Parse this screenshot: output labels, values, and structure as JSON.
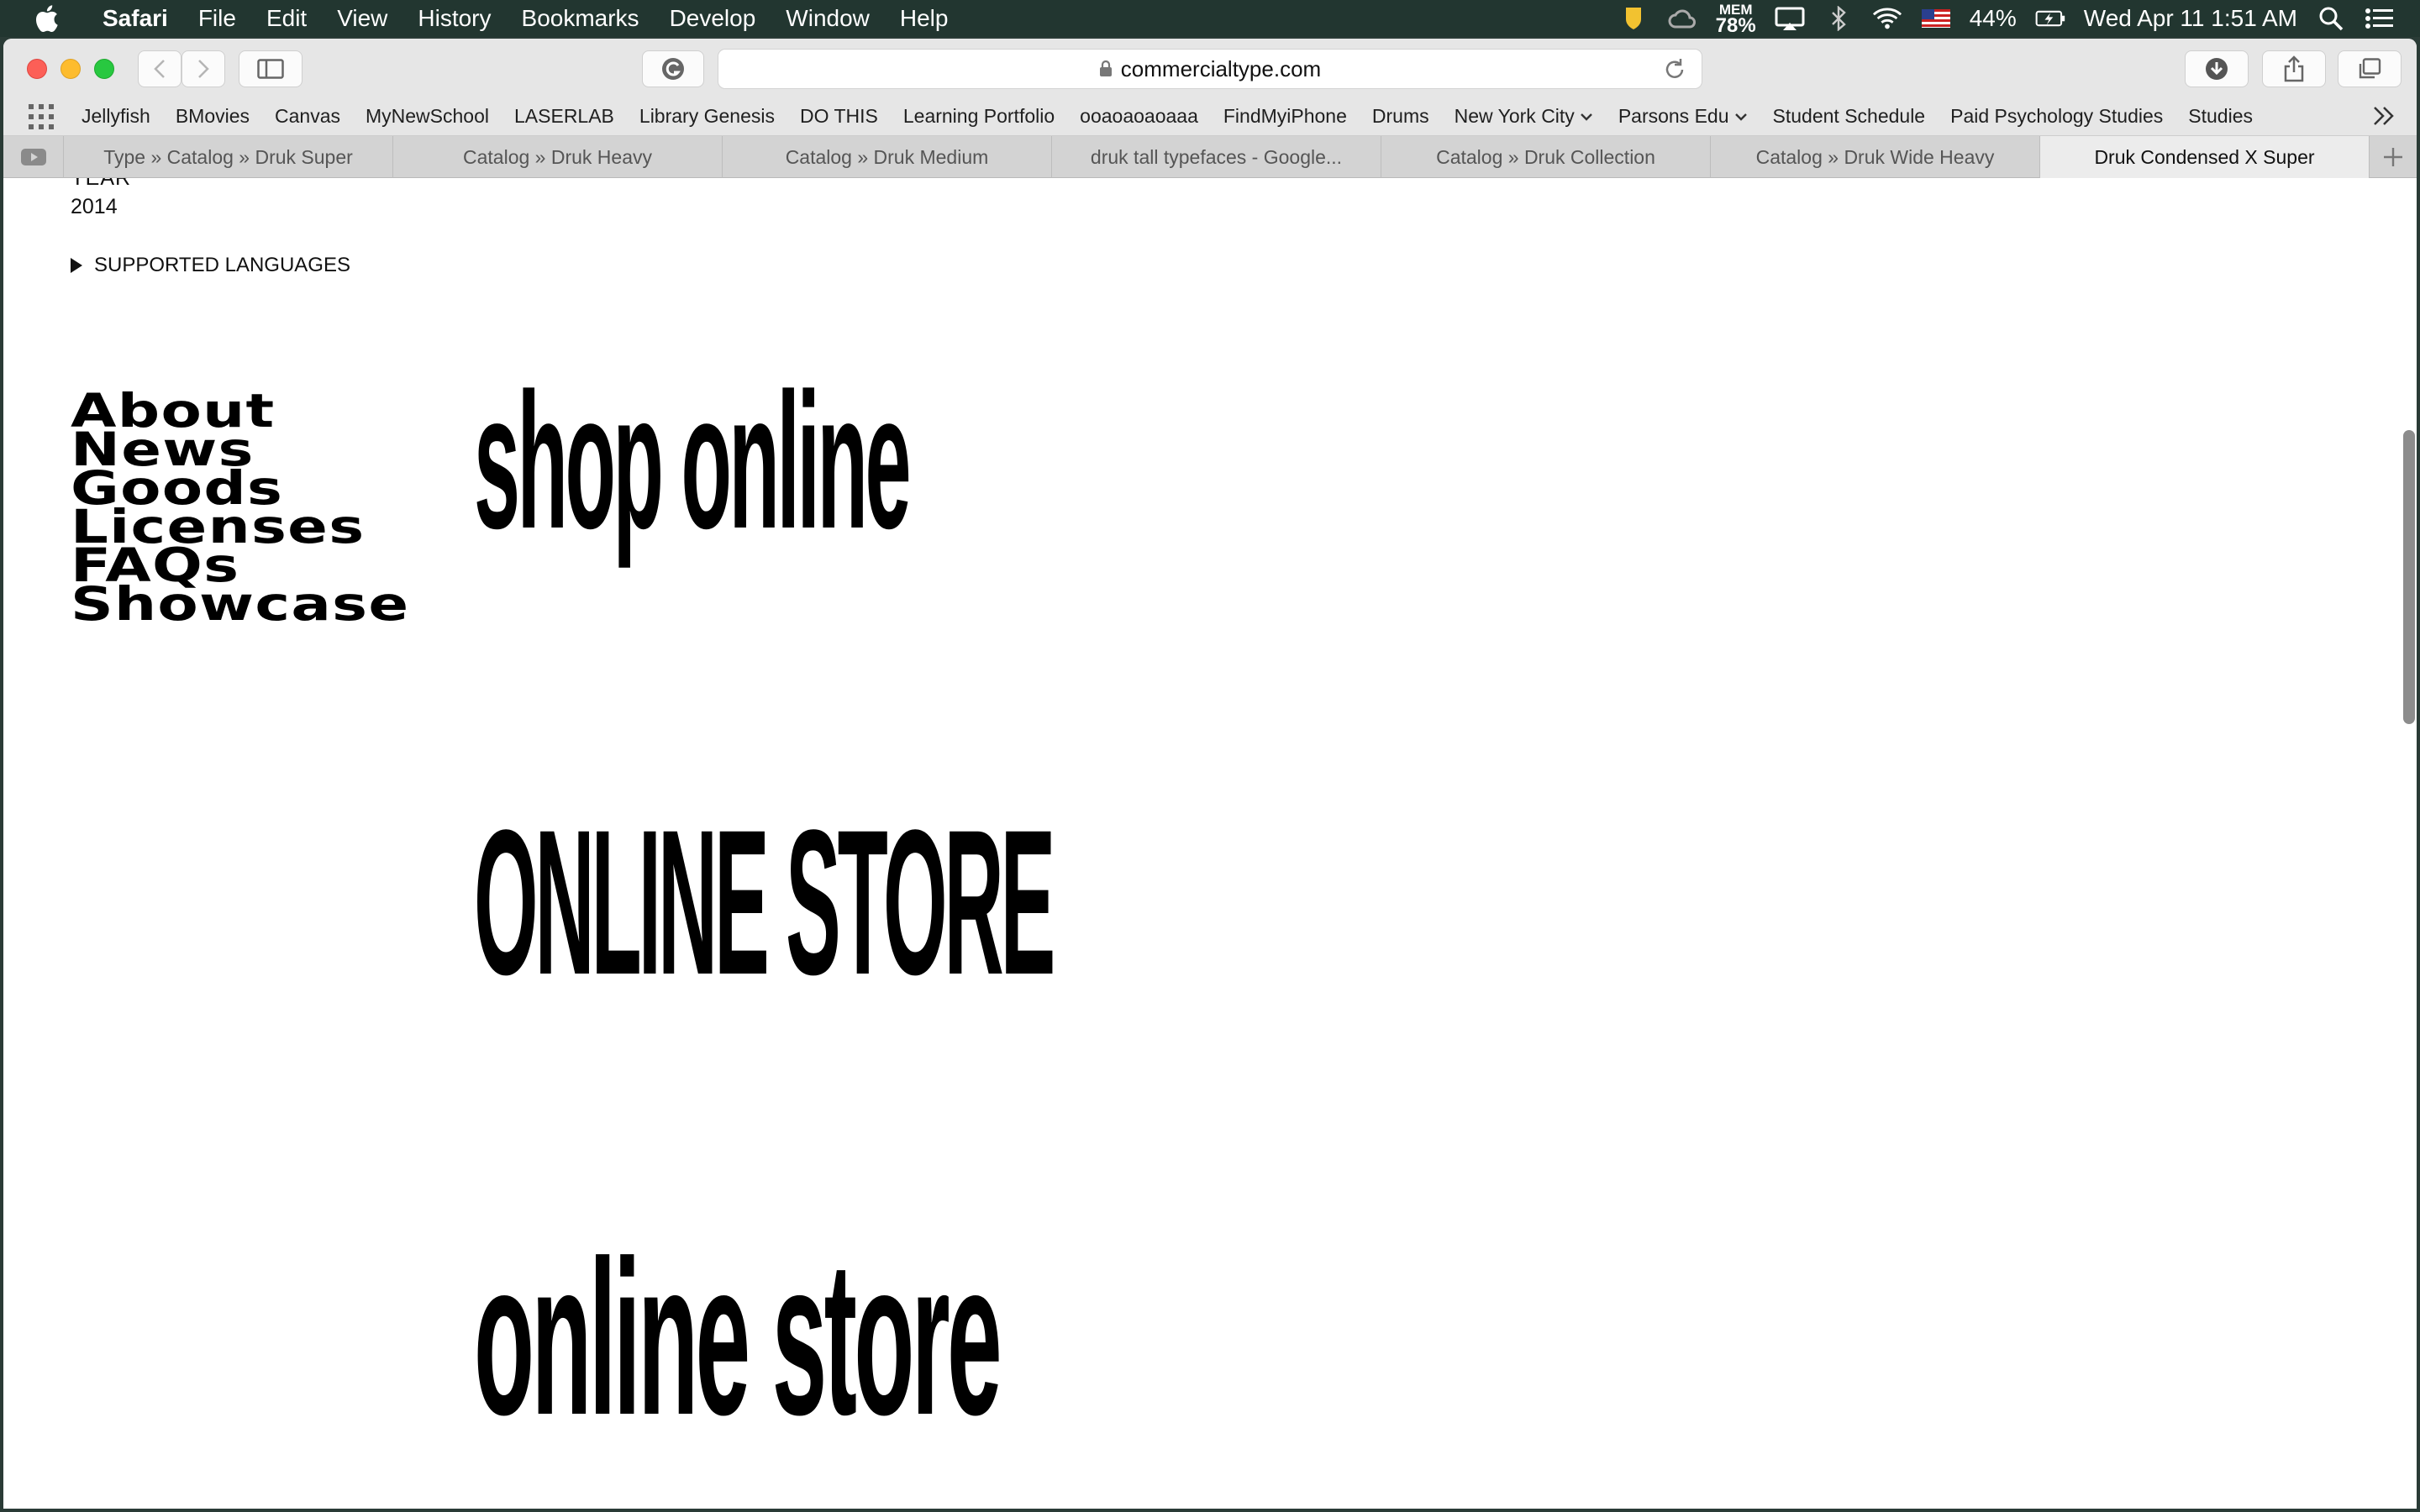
{
  "menubar": {
    "app": "Safari",
    "items": [
      "File",
      "Edit",
      "View",
      "History",
      "Bookmarks",
      "Develop",
      "Window",
      "Help"
    ],
    "status": {
      "mem_label": "MEM",
      "mem_value": "78%",
      "battery": "44%",
      "datetime": "Wed Apr 11  1:51 AM"
    }
  },
  "toolbar": {
    "url": "commercialtype.com"
  },
  "bookmarks": [
    "Jellyfish",
    "BMovies",
    "Canvas",
    "MyNewSchool",
    "LASERLAB",
    "Library Genesis",
    "DO THIS",
    "Learning Portfolio",
    "ooaoaoaoaaa",
    "FindMyiPhone",
    "Drums",
    "New York City",
    "Parsons Edu",
    "Student Schedule",
    "Paid Psychology Studies",
    "Studies"
  ],
  "tabs": [
    "Type » Catalog » Druk Super",
    "Catalog » Druk Heavy",
    "Catalog » Druk Medium",
    "druk tall typefaces - Google...",
    "Catalog » Druk Collection",
    "Catalog » Druk Wide Heavy",
    "Druk Condensed X Super"
  ],
  "page": {
    "meta_label": "YEAR",
    "meta_value": "2014",
    "languages_toggle": "SUPPORTED LANGUAGES",
    "nav": [
      "About",
      "News",
      "Goods",
      "Licenses",
      "FAQs",
      "Showcase"
    ],
    "specimens": [
      "shop online",
      "ONLINE STORE",
      "online store"
    ]
  }
}
